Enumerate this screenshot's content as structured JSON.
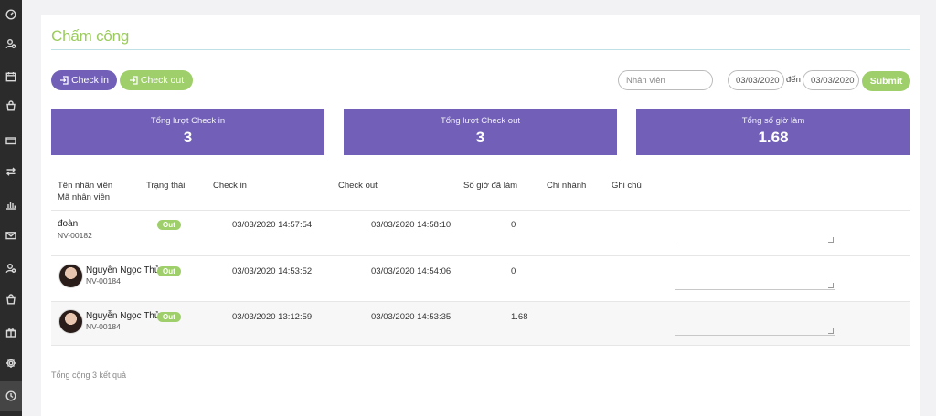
{
  "sidebar": {
    "items": [
      {
        "icon": "dashboard-icon"
      },
      {
        "icon": "users-icon"
      },
      {
        "icon": "calendar-icon"
      },
      {
        "icon": "bag-icon"
      },
      {
        "icon": "card-icon"
      },
      {
        "icon": "transfer-icon"
      },
      {
        "icon": "chart-icon"
      },
      {
        "icon": "mail-icon"
      },
      {
        "icon": "user-group-icon"
      },
      {
        "icon": "shopping-icon"
      },
      {
        "icon": "gift-icon"
      },
      {
        "icon": "gear-icon"
      },
      {
        "icon": "clock-icon",
        "active": true
      }
    ]
  },
  "page": {
    "title": "Chấm công"
  },
  "toolbar": {
    "checkin_label": "Check in",
    "checkout_label": "Check out",
    "employee_placeholder": "Nhân viên",
    "date_from": "03/03/2020",
    "date_sep": "đến",
    "date_to": "03/03/2020",
    "submit_label": "Submit"
  },
  "stats": [
    {
      "label": "Tổng lượt Check in",
      "value": "3"
    },
    {
      "label": "Tổng lượt Check out",
      "value": "3"
    },
    {
      "label": "Tổng số giờ làm",
      "value": "1.68"
    }
  ],
  "table": {
    "headers": {
      "name": "Tên nhân viên",
      "code": "Mã nhân viên",
      "status": "Trạng thái",
      "checkin": "Check in",
      "checkout": "Check out",
      "hours": "Số giờ đã làm",
      "branch": "Chi nhánh",
      "note": "Ghi chú"
    },
    "rows": [
      {
        "name": "đoàn",
        "code": "NV-00182",
        "status": "Out",
        "checkin": "03/03/2020 14:57:54",
        "checkout": "03/03/2020 14:58:10",
        "hours": "0",
        "avatar": false
      },
      {
        "name": "Nguyễn Ngọc Thủy",
        "code": "NV-00184",
        "status": "Out",
        "checkin": "03/03/2020 14:53:52",
        "checkout": "03/03/2020 14:54:06",
        "hours": "0",
        "avatar": true
      },
      {
        "name": "Nguyễn Ngọc Thủy",
        "code": "NV-00184",
        "status": "Out",
        "checkin": "03/03/2020 13:12:59",
        "checkout": "03/03/2020 14:53:35",
        "hours": "1.68",
        "avatar": true
      }
    ]
  },
  "footer": {
    "total_text": "Tổng cộng 3 kết quả"
  },
  "colors": {
    "primary": "#7260b8",
    "accent": "#9fcf6a",
    "sidebar": "#2b2b2b"
  }
}
